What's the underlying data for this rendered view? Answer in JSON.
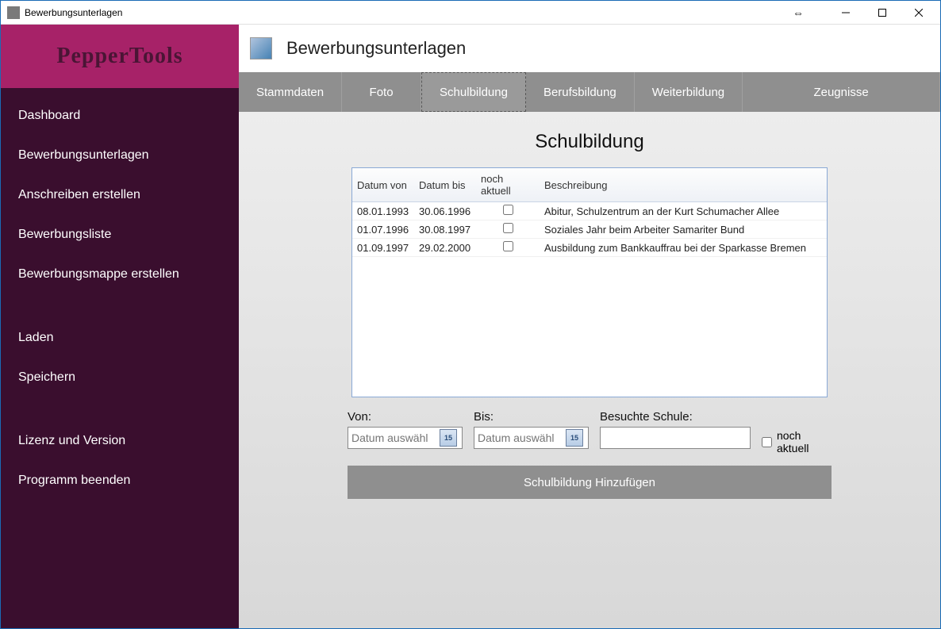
{
  "window": {
    "title": "Bewerbungsunterlagen"
  },
  "logo": "PepperTools",
  "sidebar": {
    "items": [
      {
        "label": "Dashboard"
      },
      {
        "label": "Bewerbungsunterlagen"
      },
      {
        "label": "Anschreiben erstellen"
      },
      {
        "label": "Bewerbungsliste"
      },
      {
        "label": "Bewerbungsmappe erstellen"
      }
    ],
    "items2": [
      {
        "label": "Laden"
      },
      {
        "label": "Speichern"
      }
    ],
    "items3": [
      {
        "label": "Lizenz und Version"
      },
      {
        "label": "Programm beenden"
      }
    ]
  },
  "header": {
    "title": "Bewerbungsunterlagen"
  },
  "tabs": [
    {
      "label": "Stammdaten"
    },
    {
      "label": "Foto"
    },
    {
      "label": "Schulbildung",
      "active": true
    },
    {
      "label": "Berufsbildung"
    },
    {
      "label": "Weiterbildung"
    },
    {
      "label": "Zeugnisse"
    }
  ],
  "section_title": "Schulbildung",
  "grid": {
    "headers": {
      "von": "Datum von",
      "bis": "Datum bis",
      "aktuell": "noch aktuell",
      "desc": "Beschreibung"
    },
    "rows": [
      {
        "von": "08.01.1993",
        "bis": "30.06.1996",
        "aktuell": false,
        "desc": "Abitur, Schulzentrum an der Kurt Schumacher Allee"
      },
      {
        "von": "01.07.1996",
        "bis": "30.08.1997",
        "aktuell": false,
        "desc": "Soziales Jahr beim Arbeiter Samariter Bund"
      },
      {
        "von": "01.09.1997",
        "bis": "29.02.2000",
        "aktuell": false,
        "desc": "Ausbildung zum Bankkauffrau bei der Sparkasse Bremen"
      }
    ]
  },
  "form": {
    "von_label": "Von:",
    "bis_label": "Bis:",
    "schule_label": "Besuchte Schule:",
    "aktuell_label": "noch aktuell",
    "date_placeholder": "Datum auswähl",
    "date_btn": "15",
    "add_button": "Schulbildung Hinzufügen"
  }
}
